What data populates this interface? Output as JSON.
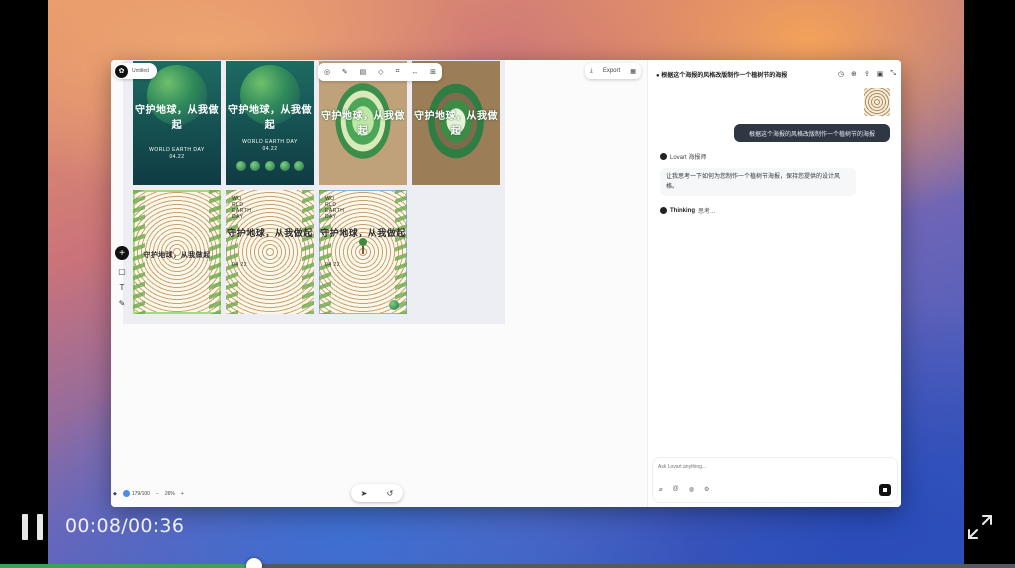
{
  "app": {
    "doc_title": "Untitled"
  },
  "toolbar": {
    "export_label": "Export"
  },
  "posters": [
    {
      "title": "守护地球，从我做起",
      "subtitle": "WORLD EARTH DAY",
      "date": "04.22"
    },
    {
      "title": "守护地球，从我做起",
      "subtitle": "WORLD EARTH DAY",
      "date": "04.22"
    },
    {
      "title": "守护地球，从我做起"
    },
    {
      "title": "守护地球，从我做起"
    },
    {
      "title": "守护地球，从我做起"
    },
    {
      "title": "守护地球，从我做起",
      "side_text": "WO RLD EARTH DAY",
      "date": "04 22"
    },
    {
      "title": "守护地球，从我做起",
      "side_text": "WO RLD EARTH DAY",
      "date": "04 22"
    }
  ],
  "bottom_bar": {
    "credits": "179/100",
    "zoom": "26%"
  },
  "chat": {
    "header_title": "● 根据这个海报的风格改版制作一个植树节的海报",
    "user_message": "根据这个海报的风格改版制作一个植树节的海报",
    "agent_name": "Lovart 海报师",
    "agent_message": "让我思考一下如何为您制作一个植树节海报，保持您提供的设计风格。",
    "thinking_label": "Thinking",
    "thinking_text": "思考...",
    "input_placeholder": "Ask Lovart anything..."
  },
  "player": {
    "time_display": "00:08/00:36",
    "progress": 0.25
  },
  "colors": {
    "accent_green": "#3aa357",
    "user_bubble": "#2f3744"
  },
  "icons": {
    "pause": "pause-icon",
    "fullscreen": "fullscreen-icon",
    "add": "plus-icon",
    "send": "stop-icon"
  }
}
